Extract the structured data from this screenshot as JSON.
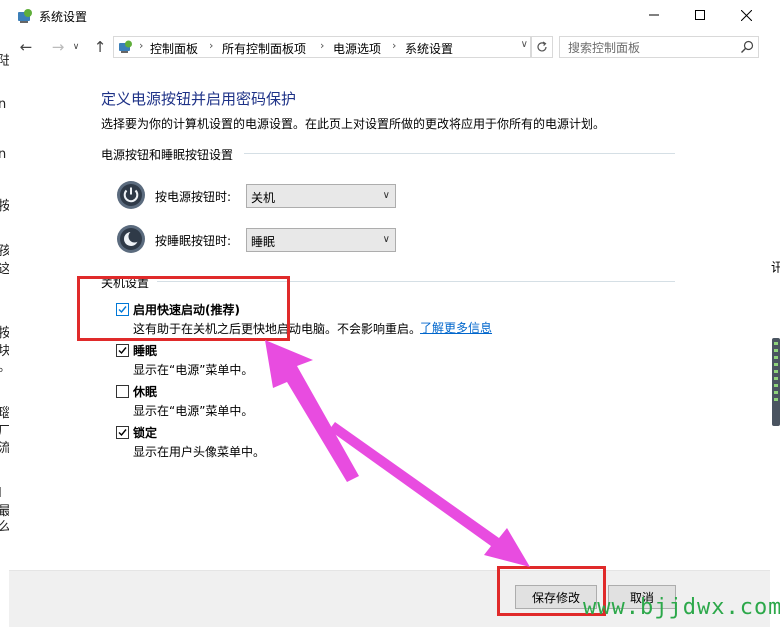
{
  "window": {
    "title": "系统设置",
    "controls": {
      "minimize": "—",
      "maximize": "☐",
      "close": "✕"
    }
  },
  "nav": {
    "back": "←",
    "forward": "→",
    "history": "∨",
    "up": "↑"
  },
  "breadcrumbs": [
    "控制面板",
    "所有控制面板项",
    "电源选项",
    "系统设置"
  ],
  "breadcrumb_separator": "›",
  "search": {
    "placeholder": "搜索控制面板"
  },
  "content": {
    "heading": "定义电源按钮并启用密码保护",
    "description": "选择要为你的计算机设置的电源设置。在此页上对设置所做的更改将应用于你所有的电源计划。",
    "power_group_title": "电源按钮和睡眠按钮设置",
    "power_button": {
      "label": "按电源按钮时:",
      "value": "关机"
    },
    "sleep_button": {
      "label": "按睡眠按钮时:",
      "value": "睡眠"
    },
    "shutdown_group_title": "关机设置",
    "options": [
      {
        "label": "启用快速启动(推荐)",
        "desc": "这有助于在关机之后更快地启动电脑。不会影响重启。",
        "checked": true
      },
      {
        "label": "睡眠",
        "desc": "显示在“电源”菜单中。",
        "checked": true
      },
      {
        "label": "休眠",
        "desc": "显示在“电源”菜单中。",
        "checked": false
      },
      {
        "label": "锁定",
        "desc": "显示在用户头像菜单中。",
        "checked": true
      }
    ],
    "learn_more": "了解更多信息"
  },
  "footer": {
    "save": "保存修改",
    "cancel": "取消"
  },
  "watermark": "www.bjjdwx.com",
  "background_window": {
    "left_glyphs": [
      "陆",
      "n",
      "n",
      "按",
      "孩",
      "这",
      "按",
      "块",
      "。",
      "瑙",
      "厂",
      "流",
      "I",
      "最",
      "么"
    ],
    "right_glyph": "讯"
  },
  "colors": {
    "heading": "#1e3287",
    "link": "#0066cc",
    "annotation_box": "#e02a2a",
    "annotation_arrow": "#e84ce0",
    "watermark": "#2ca84a"
  }
}
